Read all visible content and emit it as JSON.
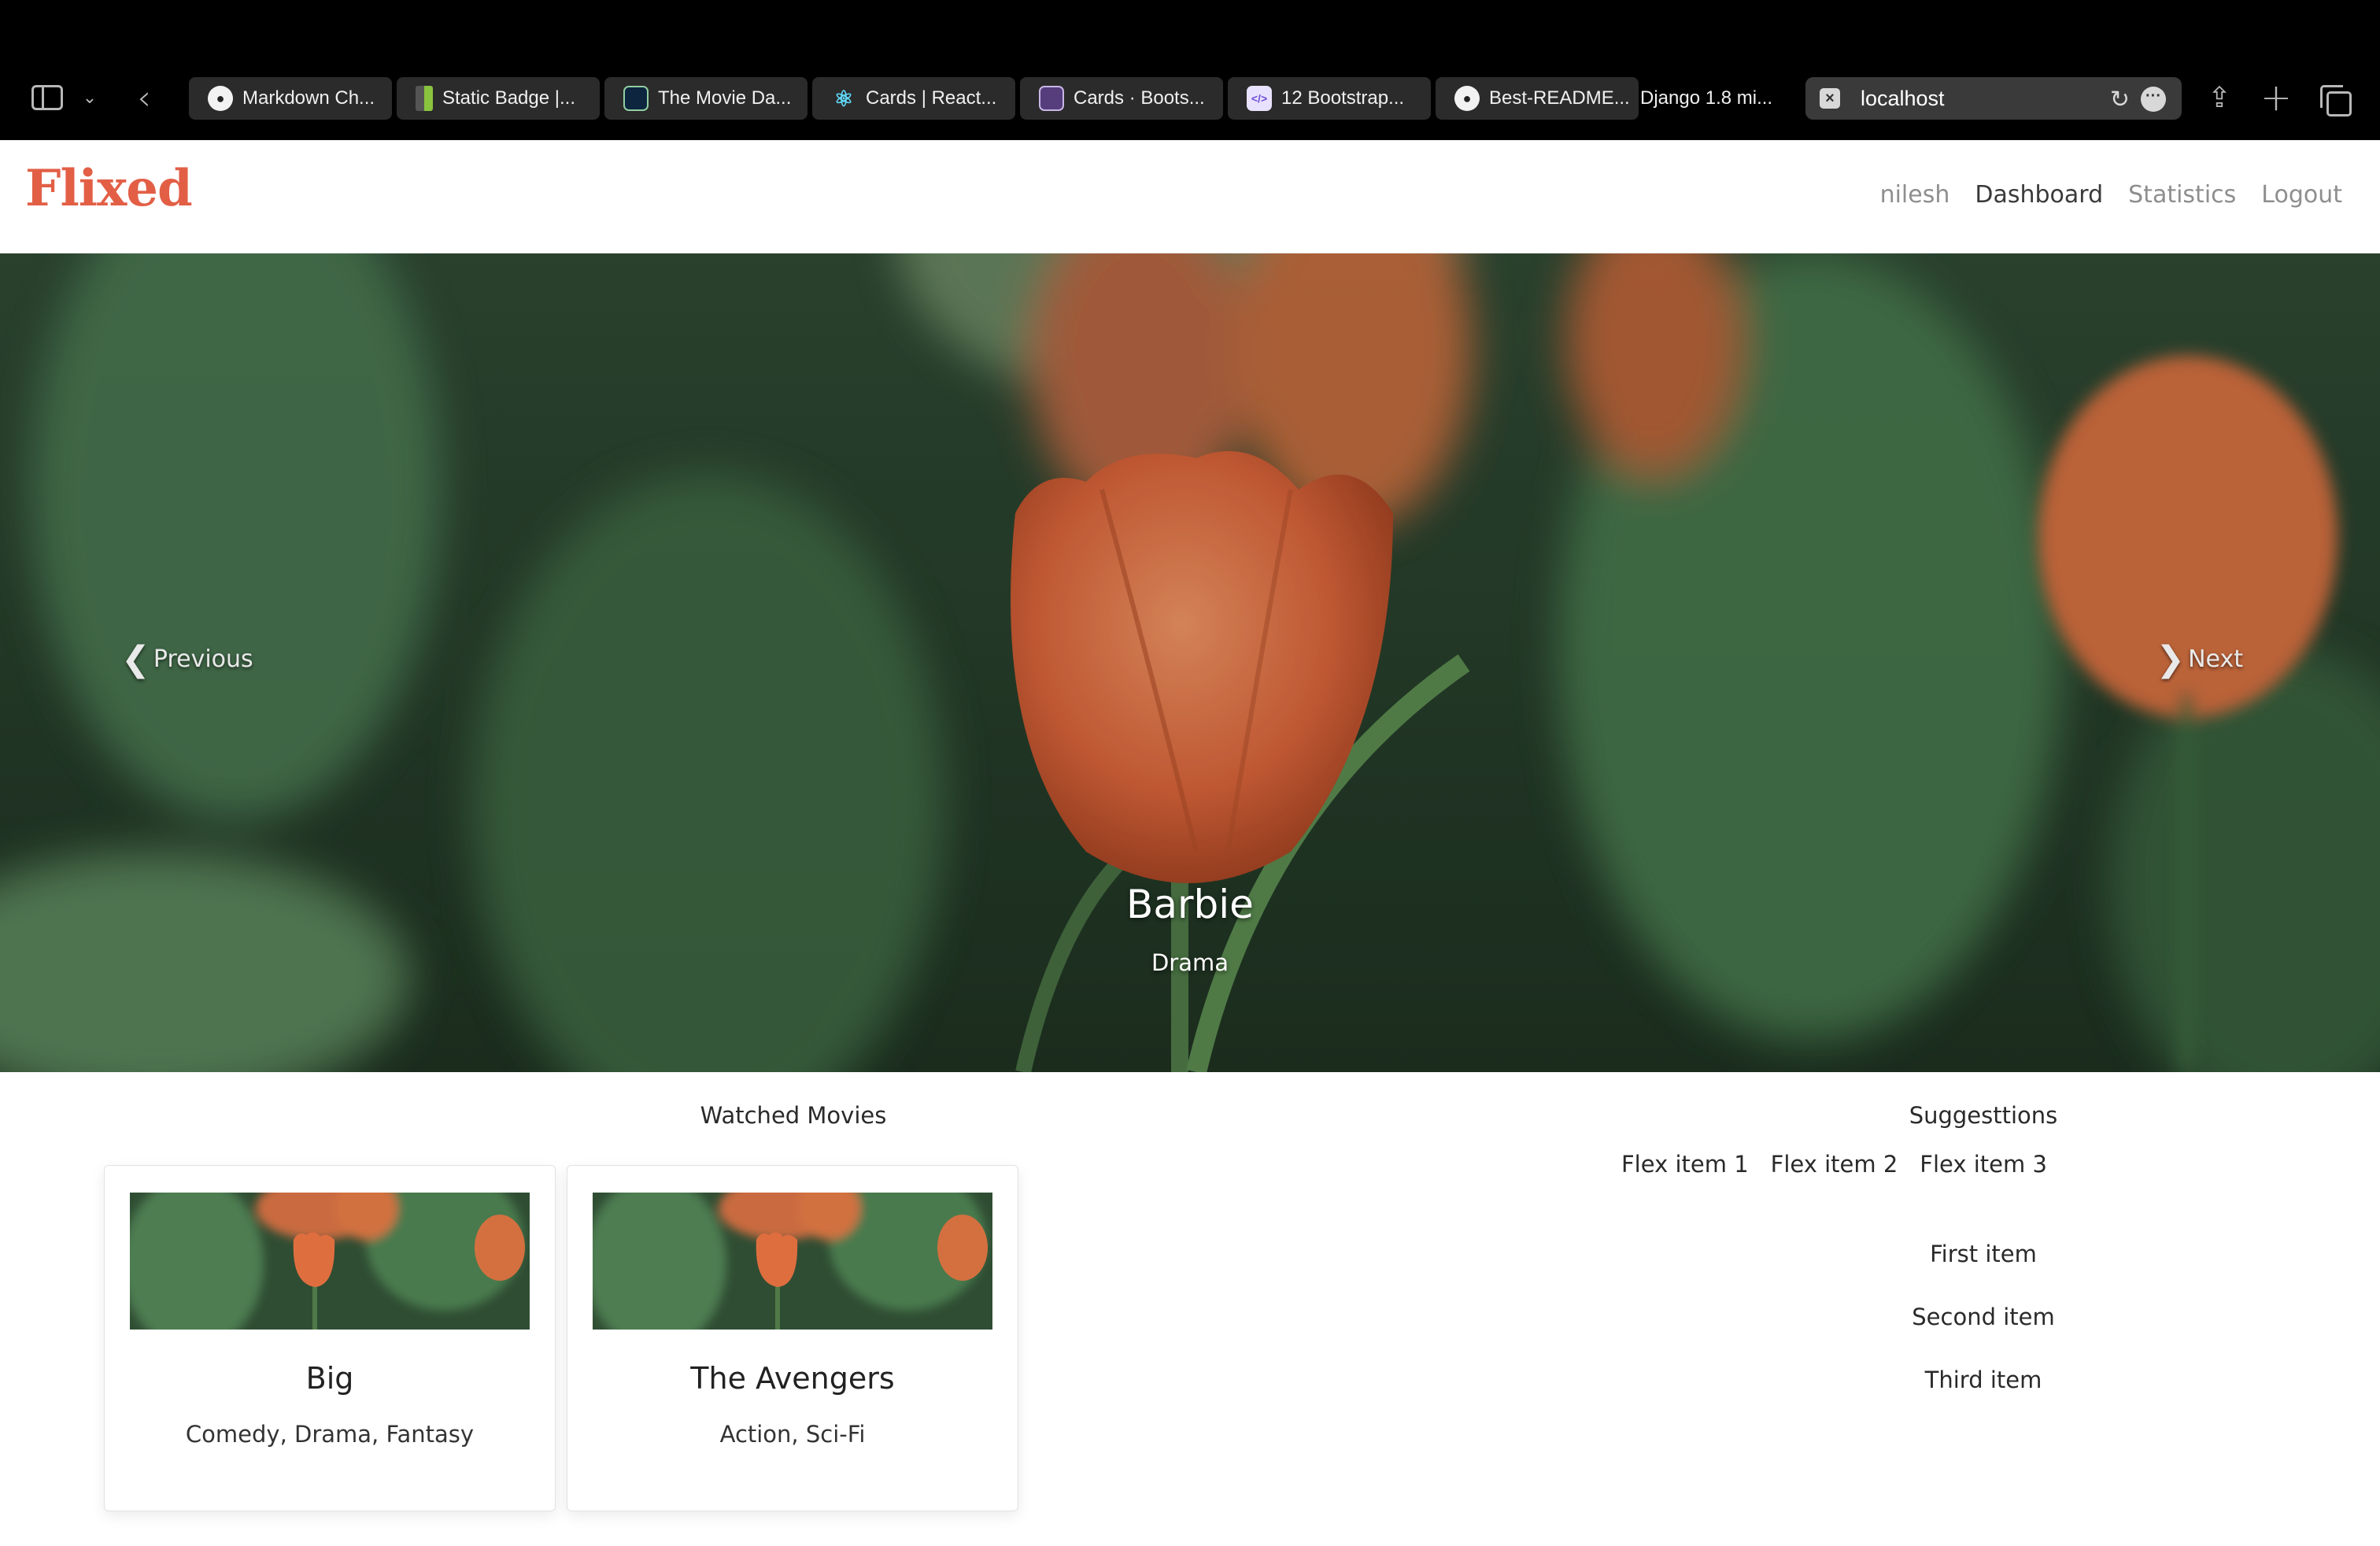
{
  "browser": {
    "tabs": [
      {
        "label": "Markdown Ch...",
        "icon": "github-icon"
      },
      {
        "label": "Static Badge |...",
        "icon": "badge-icon"
      },
      {
        "label": "The Movie Da...",
        "icon": "tmdb-icon"
      },
      {
        "label": "Cards | React...",
        "icon": "react-icon"
      },
      {
        "label": "Cards · Boots...",
        "icon": "bootstrap-icon"
      },
      {
        "label": "12 Bootstrap...",
        "icon": "code-icon"
      },
      {
        "label": "Best-README...",
        "icon": "github-icon"
      },
      {
        "label": "Django 1.8 mi...",
        "icon": ""
      }
    ],
    "url": "localhost"
  },
  "navbar": {
    "brand": "Flixed",
    "user": "nilesh",
    "links": [
      "Dashboard",
      "Statistics",
      "Logout"
    ]
  },
  "carousel": {
    "prev_label": "Previous",
    "next_label": "Next",
    "caption_title": "Barbie",
    "caption_genre": "Drama"
  },
  "watched": {
    "title": "Watched Movies",
    "movies": [
      {
        "title": "Big",
        "genres": "Comedy, Drama, Fantasy"
      },
      {
        "title": "The Avengers",
        "genres": "Action, Sci-Fi"
      }
    ]
  },
  "suggestions": {
    "title": "Suggesttions",
    "flex_items": [
      "Flex item 1",
      "Flex item 2",
      "Flex item 3"
    ],
    "list_items": [
      "First item",
      "Second item",
      "Third item"
    ]
  },
  "colors": {
    "brand": "#e25f46",
    "chrome_bg": "#000000",
    "tab_bg": "#2b2b2b"
  }
}
